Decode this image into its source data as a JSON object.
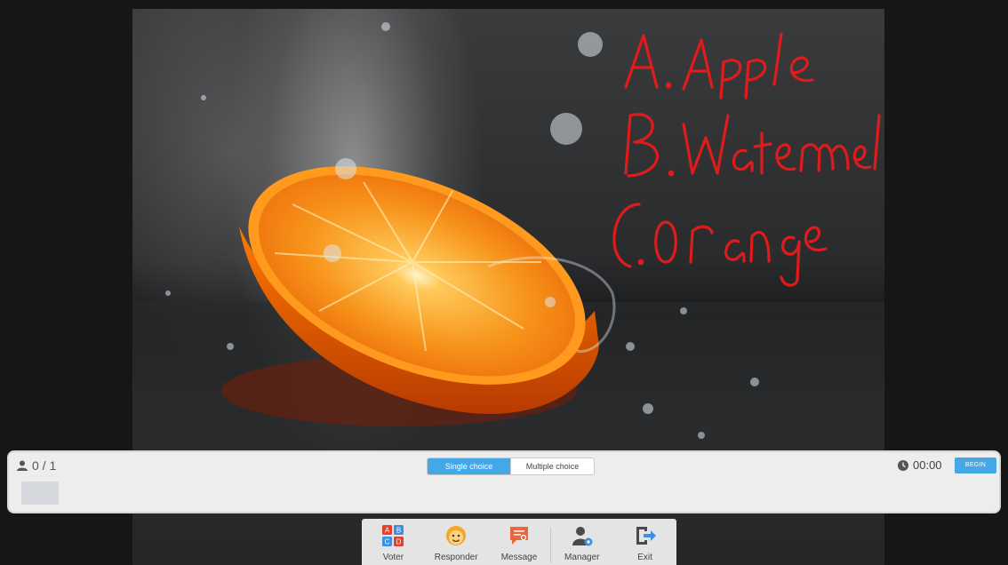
{
  "slide": {
    "annotations": [
      "A. Apple",
      "B. Watermelon",
      "C. Orange"
    ]
  },
  "panel": {
    "participants": "0 / 1",
    "modes": {
      "single": "Single choice",
      "multiple": "Multiple choice",
      "selected": "single"
    },
    "timer": "00:00",
    "begin": "BEGIN"
  },
  "dock": {
    "items": [
      {
        "label": "Voter",
        "icon": "abcd-grid-icon"
      },
      {
        "label": "Responder",
        "icon": "emoji-face-icon"
      },
      {
        "label": "Message",
        "icon": "message-icon"
      },
      {
        "label": "Manager",
        "icon": "user-gear-icon"
      },
      {
        "label": "Exit",
        "icon": "exit-icon"
      }
    ]
  },
  "colors": {
    "accent": "#43a8e5",
    "ink": "#e01b1b"
  }
}
